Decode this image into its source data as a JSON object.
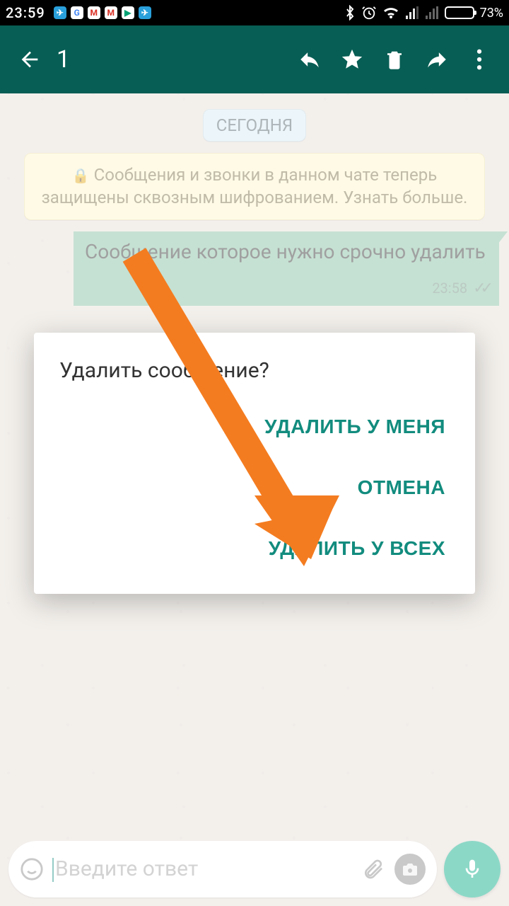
{
  "status": {
    "time": "23:59",
    "battery_pct": "73%",
    "battery_fill": 73
  },
  "actionbar": {
    "selected_count": "1"
  },
  "chat": {
    "date_chip": "СЕГОДНЯ",
    "encryption_text": "Сообщения и звонки в данном чате теперь защищены сквозным шифрованием. Узнать больше.",
    "message_text": "Сообщение которое нужно срочно удалить",
    "message_time": "23:58"
  },
  "dialog": {
    "title": "Удалить сообщение?",
    "delete_for_me": "УДАЛИТЬ У МЕНЯ",
    "cancel": "ОТМЕНА",
    "delete_for_all": "УДАЛИТЬ У ВСЕХ"
  },
  "input": {
    "placeholder": "Введите ответ"
  }
}
